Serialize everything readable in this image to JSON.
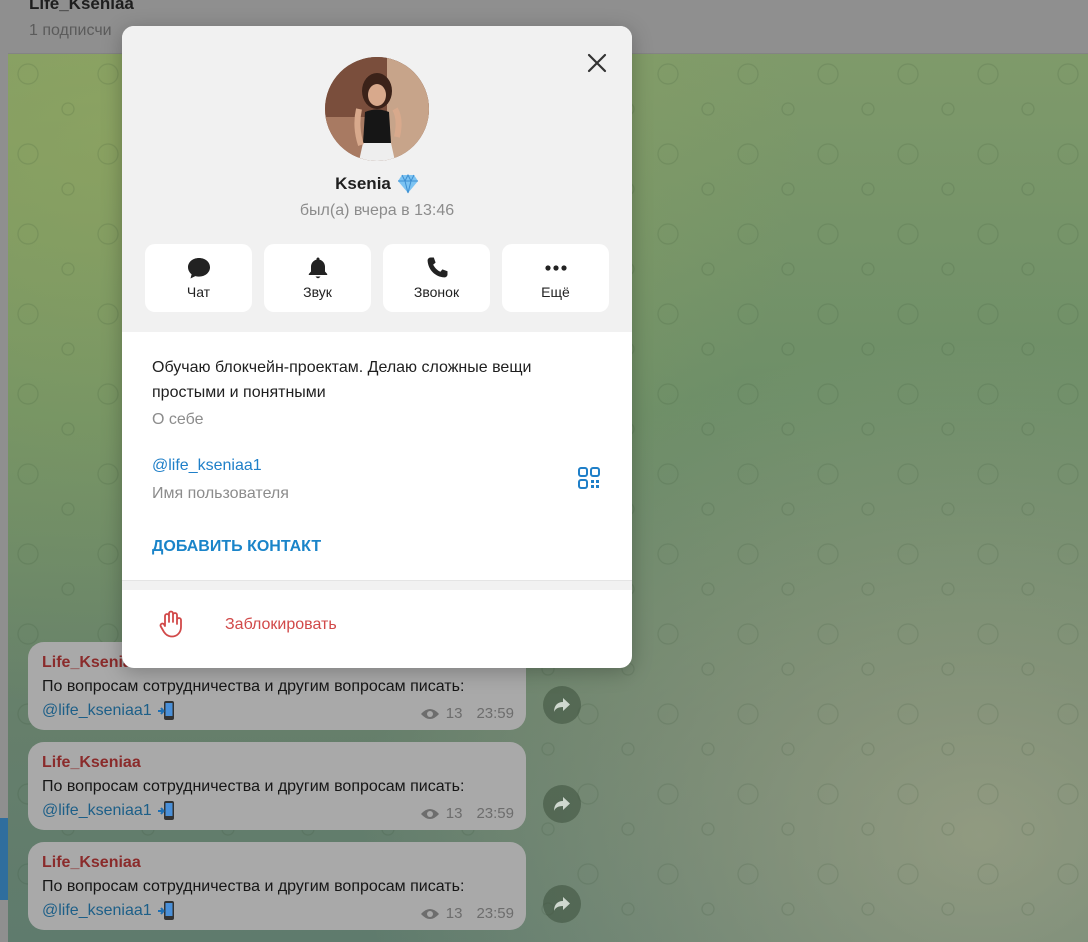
{
  "header": {
    "title": "Life_Kseniaa",
    "subtitle": "1 подписчи"
  },
  "messages": [
    {
      "author": "Life_Kseniaa",
      "text": "По вопросам сотрудничества и другим вопросам писать:",
      "link": "@life_kseniaa1",
      "views": "13",
      "time": "23:59"
    },
    {
      "author": "Life_Kseniaa",
      "text": "По вопросам сотрудничества и другим вопросам писать:",
      "link": "@life_kseniaa1",
      "views": "13",
      "time": "23:59"
    },
    {
      "author": "Life_Kseniaa",
      "text": "По вопросам сотрудничества и другим вопросам писать:",
      "link": "@life_kseniaa1",
      "views": "13",
      "time": "23:59"
    }
  ],
  "profile": {
    "name": "Ksenia",
    "status": "был(а) вчера в 13:46",
    "actions": [
      {
        "label": "Чат",
        "icon": "chat-icon"
      },
      {
        "label": "Звук",
        "icon": "bell-icon"
      },
      {
        "label": "Звонок",
        "icon": "phone-icon"
      },
      {
        "label": "Ещё",
        "icon": "more-icon"
      }
    ],
    "bio": "Обучаю блокчейн-проектам. Делаю сложные вещи простыми и понятными",
    "bio_label": "О себе",
    "username": "@life_kseniaa1",
    "username_label": "Имя пользователя",
    "add_contact": "ДОБАВИТЬ КОНТАКТ",
    "block": "Заблокировать"
  },
  "colors": {
    "accent": "#1a84c9",
    "danger": "#d14949",
    "author": "#8a2b2b"
  }
}
